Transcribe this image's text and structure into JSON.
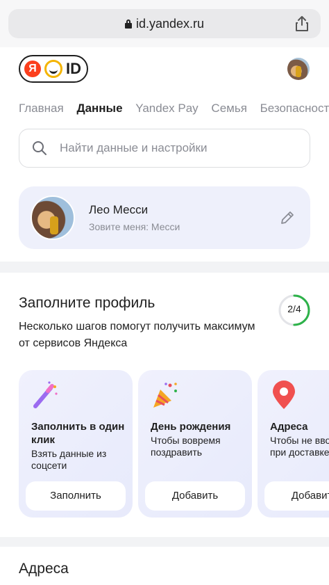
{
  "browser": {
    "url": "id.yandex.ru"
  },
  "header": {
    "logo": {
      "letter": "Я",
      "text": "ID"
    }
  },
  "tabs": [
    {
      "label": "Главная"
    },
    {
      "label": "Данные"
    },
    {
      "label": "Yandex Pay"
    },
    {
      "label": "Семья"
    },
    {
      "label": "Безопасность"
    }
  ],
  "search": {
    "placeholder": "Найти данные и настройки"
  },
  "profile": {
    "name": "Лео Месси",
    "nickname": "Зовите меня: Месси"
  },
  "fill_profile": {
    "title": "Заполните профиль",
    "description": "Несколько шагов помогут получить максимум от сервисов Яндекса",
    "progress_label": "2/4",
    "progress_fraction": 0.5,
    "progress_color": "#2eb24a",
    "cards": [
      {
        "title": "Заполнить в один клик",
        "subtitle": "Взять данные из соцсети",
        "button": "Заполнить",
        "icon": "magic-wand-icon"
      },
      {
        "title": "День рождения",
        "subtitle": "Чтобы вовремя поздравить",
        "button": "Добавить",
        "icon": "party-popper-icon"
      },
      {
        "title": "Адреса",
        "subtitle": "Чтобы не вводить их при доставке",
        "button": "Добавить",
        "icon": "location-pin-icon"
      }
    ]
  },
  "addresses": {
    "title": "Адреса"
  }
}
